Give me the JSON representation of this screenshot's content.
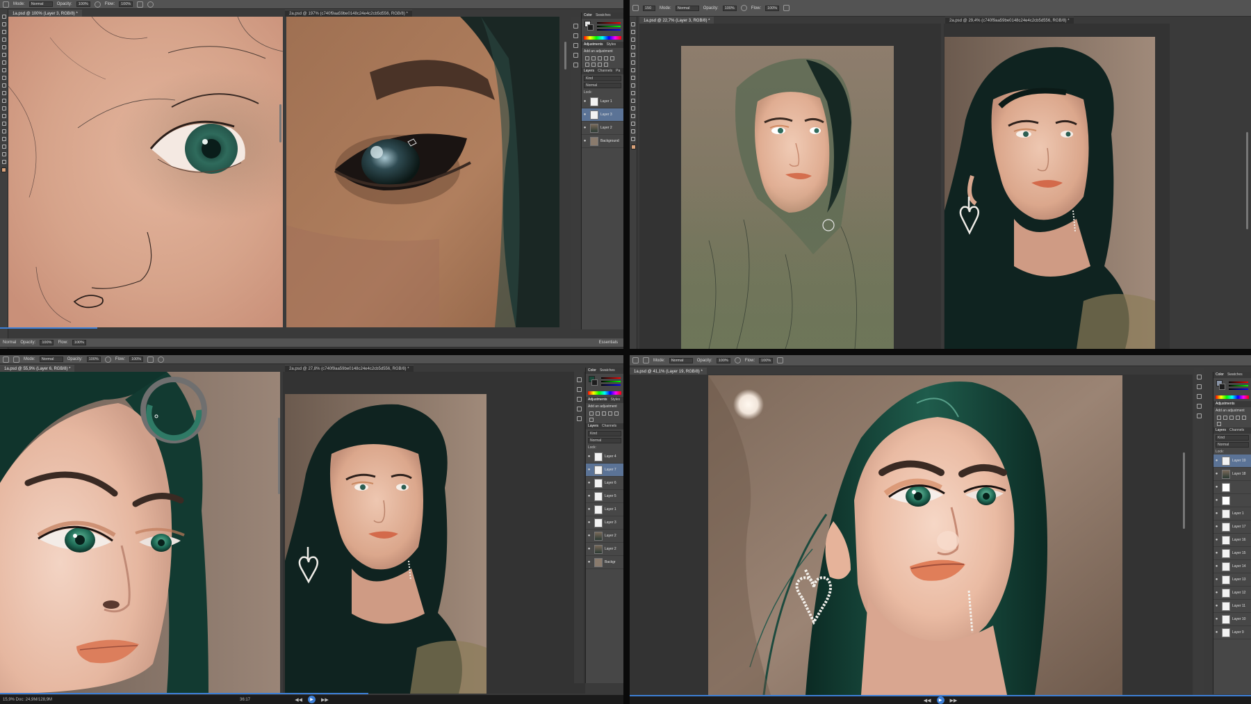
{
  "app": "Photoshop",
  "options_bar": {
    "mode_label": "Mode:",
    "mode_value": "Normal",
    "opacity_label": "Opacity:",
    "opacity_value": "100%",
    "flow_label": "Flow:",
    "flow_value": "100%",
    "brush_size": "150"
  },
  "quadrants": {
    "top_left": {
      "tab_active": "1a.psd @ 100% (Layer 3, RGB/8) *",
      "tab_second": "2a.psd @ 197% (c740f9aa59be0148c24e4c2cb5d556, RGB/8) *",
      "layers": [
        "Layer 1",
        "Layer 3",
        "Layer 2",
        "Background"
      ],
      "blend": "Normal",
      "footer_label": "Essentials"
    },
    "top_right": {
      "tab_active": "1a.psd @ 22,7% (Layer 3, RGB/8) *",
      "tab_second": "2a.psd @ 29,4% (c740f9aa59be0148c24e4c2cb5d556, RGB/8) *"
    },
    "bottom_left": {
      "tab_active": "1a.psd @ 55,9% (Layer 6, RGB/8) *",
      "tab_second": "2a.psd @ 27,8% (c740f9aa59be0148c24e4c2cb5d556, RGB/8) *",
      "layers": [
        "Layer 4",
        "Layer 7",
        "Layer 6",
        "Layer 5",
        "Layer 1",
        "Layer 3",
        "Layer 2",
        "Layer 2",
        "Backgr"
      ],
      "blend": "Normal",
      "status": "15,9%   Doc: 24,9M/128,9M",
      "time": "36:17"
    },
    "bottom_right": {
      "tab_active": "1a.psd @ 41,1% (Layer 19, RGB/8) *",
      "layers": [
        "Layer 19",
        "Layer 18",
        "",
        "",
        "Layer 1",
        "Layer 17",
        "Layer 16",
        "Layer 15",
        "Layer 14",
        "Layer 13",
        "Layer 12",
        "Layer 11",
        "Layer 10",
        "Layer 9"
      ],
      "blend": "Normal"
    }
  },
  "panels": {
    "color_tab": "Color",
    "swatches_tab": "Swatches",
    "adjustments_tab": "Adjustments",
    "styles_tab": "Styles",
    "add_adjustment": "Add an adjustment",
    "layers_tab": "Layers",
    "channels_tab": "Channels",
    "paths_tab": "Pa",
    "kind": "Kind",
    "lock_label": "Lock:"
  },
  "colors": {
    "skin": "#d9a383",
    "hair": "#0f3d33",
    "eye": "#2f6b58",
    "lips": "#d77a5a",
    "background_warm": "#8f7a68",
    "accent_blue": "#3d7fd6"
  }
}
